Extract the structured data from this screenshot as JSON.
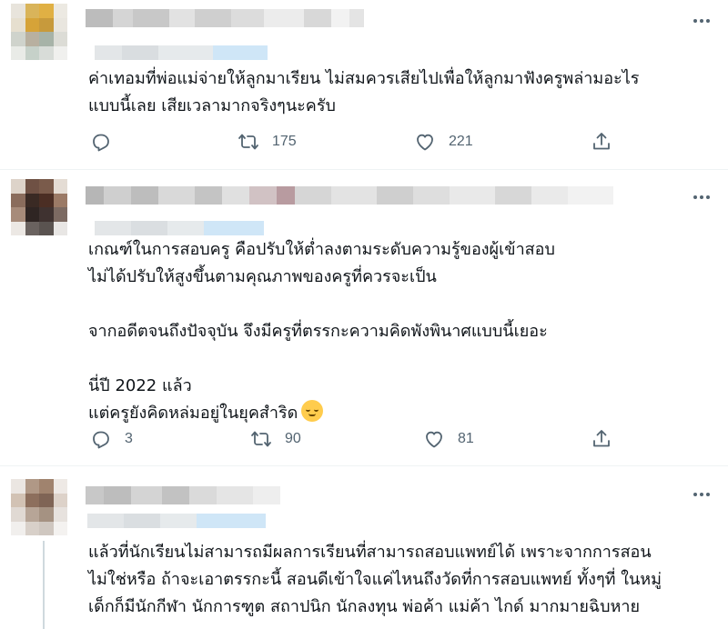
{
  "colors": {
    "text": "#0f1419",
    "muted": "#536471",
    "divider": "#eff3f4",
    "link": "#1d9bf0"
  },
  "tweets": [
    {
      "text": "ค่าเทอมที่พ่อแม่จ่ายให้ลูกมาเรียน ไม่สมควรเสียไปเพื่อให้ลูกมาฟังครูพล่ามอะไร\nแบบนี้เลย เสียเวลามากจริงๆนะครับ",
      "reply_count": "",
      "retweet_count": "175",
      "like_count": "221"
    },
    {
      "text": "เกณฑ์ในการสอบครู คือปรับให้ต่ำลงตามระดับความรู้ของผู้เข้าสอบ\nไม่ได้ปรับให้สูงขึ้นตามคุณภาพของครูที่ควรจะเป็น\n\nจากอดีตจนถึงปัจจุบัน จึงมีครูที่ตรรกะความคิดพังพินาศแบบนี้เยอะ\n\nนี่ปี 2022 แล้ว\nแต่ครูยังคิดหล่มอยู่ในยุคสำริด",
      "reply_count": "3",
      "retweet_count": "90",
      "like_count": "81"
    },
    {
      "text": "แล้วที่นักเรียนไม่สามารถมีผลการเรียนที่สามารถสอบแพทย์ได้ เพราะจากการสอน\nไม่ใช่หรือ ถ้าจะเอาตรรกะนี้ สอนดีเข้าใจแค่ไหนถึงวัดที่การสอบแพทย์ ทั้งๆที่ ในหมู่\nเด็กก็มีนักกีฬา นักการฑูต สถาปนิก นักลงทุน พ่อค้า แม่ค้า ไกด์ มากมายฉิบหาย"
    }
  ],
  "icons": [
    "reply-icon",
    "retweet-icon",
    "like-icon",
    "share-icon",
    "more-icon",
    "emoji-relieved-icon"
  ]
}
